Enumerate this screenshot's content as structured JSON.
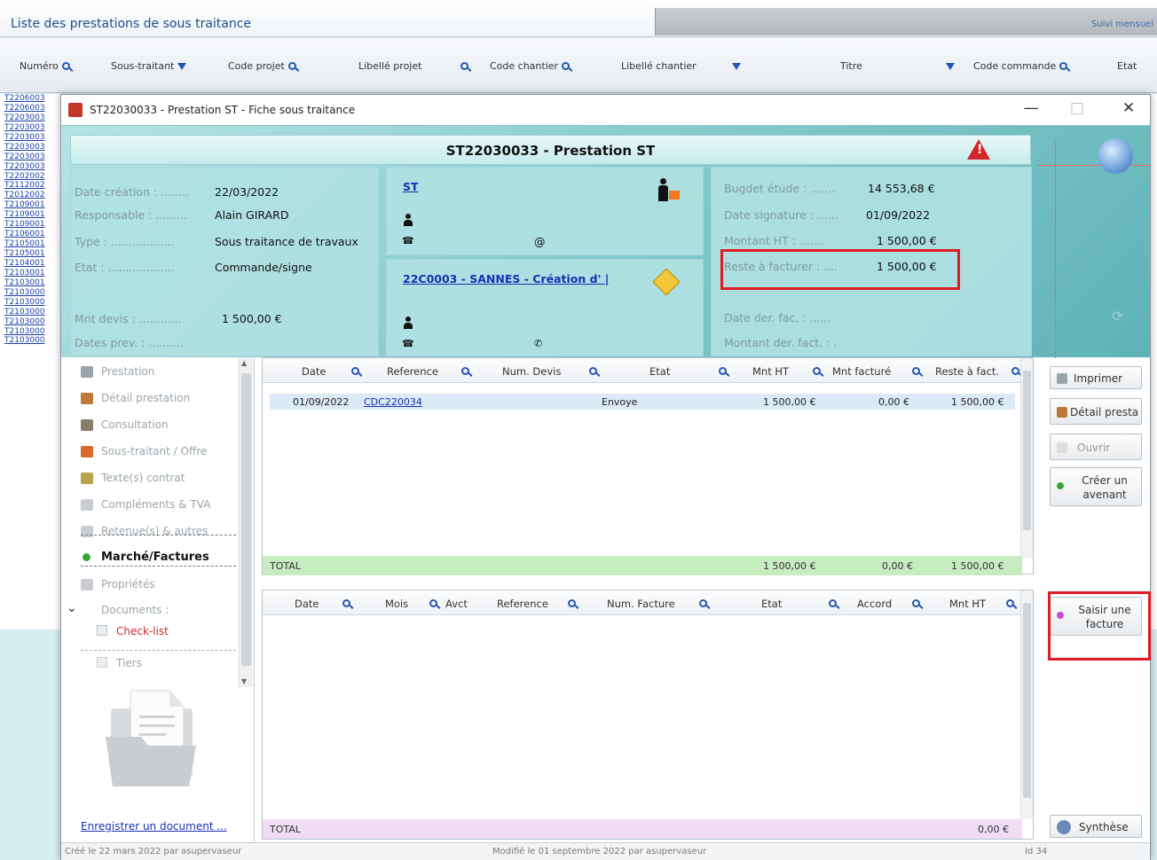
{
  "background": {
    "title": "Liste des prestations de sous traitance",
    "right_link": "Suivi mensuel",
    "columns": [
      {
        "label": "Numéro",
        "icon": "search-icon"
      },
      {
        "label": "Sous-traitant",
        "icon": "filter-icon"
      },
      {
        "label": "Code projet",
        "icon": "search-icon"
      },
      {
        "label": "Libellé projet",
        "icon": "search-icon"
      },
      {
        "label": "Code chantier",
        "icon": "search-icon"
      },
      {
        "label": "Libellé chantier",
        "icon": "filter-icon"
      },
      {
        "label": "Titre",
        "icon": "filter-icon"
      },
      {
        "label": "Code commande",
        "icon": "search-icon"
      },
      {
        "label": "Etat",
        "icon": ""
      }
    ],
    "ids": [
      "T2206003",
      "T2206003",
      "T2203003",
      "T2203003",
      "T2203003",
      "T2203003",
      "T2203003",
      "T2203003",
      "T2202002",
      "T2112002",
      "T2012002",
      "T2109001",
      "T2109001",
      "T2109001",
      "T2106001",
      "T2105001",
      "T2105001",
      "T2104001",
      "T2103001",
      "T2103001",
      "T2103000",
      "T2103000",
      "T2103000",
      "T2103000",
      "T2103000",
      "T2103000"
    ]
  },
  "window": {
    "title": "ST22030033 - Prestation ST - Fiche sous traitance",
    "controls": {
      "minimize": "—",
      "maximize": "□",
      "close": "✕"
    }
  },
  "header": {
    "title": "ST22030033 - Prestation ST",
    "left": {
      "date_creation_label": "Date création : ........",
      "date_creation": "22/03/2022",
      "responsable_label": "Responsable : .........",
      "responsable": "Alain GIRARD",
      "type_label": "Type : ..................",
      "type": "Sous traitance de travaux",
      "etat_label": "Etat : ...................",
      "etat": "Commande/signe",
      "mnt_devis_label": "Mnt devis : ............",
      "mnt_devis": "1 500,00 €",
      "dates_prev_label": "Dates prev. : .........."
    },
    "middle": {
      "st_link": "ST",
      "at_symbol": "@",
      "chantier_link": "22C0003 - SANNES - Création d' |"
    },
    "right": {
      "budget_label": "Bugdet étude : .......",
      "budget": "14 553,68 €",
      "date_signature_label": "Date signature : ......",
      "date_signature": "01/09/2022",
      "montant_ht_label": "Montant HT : .......",
      "montant_ht": "1 500,00 €",
      "reste_label": "Reste à facturer : ....",
      "reste": "1 500,00 €",
      "date_der_label": "Date der. fac. : ......",
      "montant_der_label": "Montant der. fact. : ."
    }
  },
  "nav": {
    "items": [
      {
        "label": "Prestation",
        "icon": "gear-icon",
        "color": "#9aa4ab"
      },
      {
        "label": "Détail prestation",
        "icon": "list-icon",
        "color": "#c0783a"
      },
      {
        "label": "Consultation",
        "icon": "people-icon",
        "color": "#8a7c6a"
      },
      {
        "label": "Sous-traitant / Offre",
        "icon": "contractor-icon",
        "color": "#d86a2a"
      },
      {
        "label": "Texte(s) contrat",
        "icon": "pen-icon",
        "color": "#b8a44a"
      },
      {
        "label": "Compléments & TVA",
        "icon": "document-icon",
        "color": "#c9cdd1"
      },
      {
        "label": "Retenue(s) & autres",
        "icon": "document-icon",
        "color": "#c9cdd1"
      },
      {
        "label": "Marché/Factures",
        "icon": "dot-icon",
        "color": "#3aa43a"
      },
      {
        "label": "Propriétés",
        "icon": "page-icon",
        "color": "#c9cdd1"
      },
      {
        "label": "Documents :",
        "icon": "chevron-down-icon",
        "color": "#777"
      }
    ],
    "sub_items": [
      {
        "label": "Check-list",
        "color": "#d0262a"
      },
      {
        "label": "Tiers",
        "color": "#9aa4ab"
      }
    ],
    "register_link": "Enregistrer un document ..."
  },
  "grid_top": {
    "columns": [
      "Date",
      "Reference",
      "Num. Devis",
      "Etat",
      "Mnt HT",
      "Mnt facturé",
      "Reste à fact."
    ],
    "rows": [
      {
        "date": "01/09/2022",
        "reference": "CDC220034",
        "num_devis": "",
        "etat": "Envoye",
        "mnt_ht": "1 500,00 €",
        "mnt_facture": "0,00 €",
        "reste": "1 500,00 €"
      }
    ],
    "total_label": "TOTAL",
    "total_mnt_ht": "1 500,00 €",
    "total_facture": "0,00 €",
    "total_reste": "1 500,00 €"
  },
  "grid_bottom": {
    "columns": [
      "Date",
      "Mois",
      "Avct",
      "Reference",
      "Num. Facture",
      "Etat",
      "Accord",
      "Mnt HT"
    ],
    "total_label": "TOTAL",
    "total_value": "0,00 €"
  },
  "buttons": {
    "imprimer": "Imprimer",
    "detail_presta": "Détail presta",
    "ouvrir": "Ouvrir",
    "creer_avenant": "Créer un avenant",
    "saisir_facture": "Saisir une facture",
    "synthese": "Synthèse"
  },
  "status": {
    "created": "Créé le 22 mars 2022 par asupervaseur",
    "modified": "Modifié le 01 septembre 2022 par asupervaseur",
    "id": "Id 34"
  },
  "colors": {
    "highlight_red": "#e01b22",
    "teal": "#7fc7c9",
    "total_green": "#c6edbf",
    "total_pink": "#f0dcf4"
  }
}
